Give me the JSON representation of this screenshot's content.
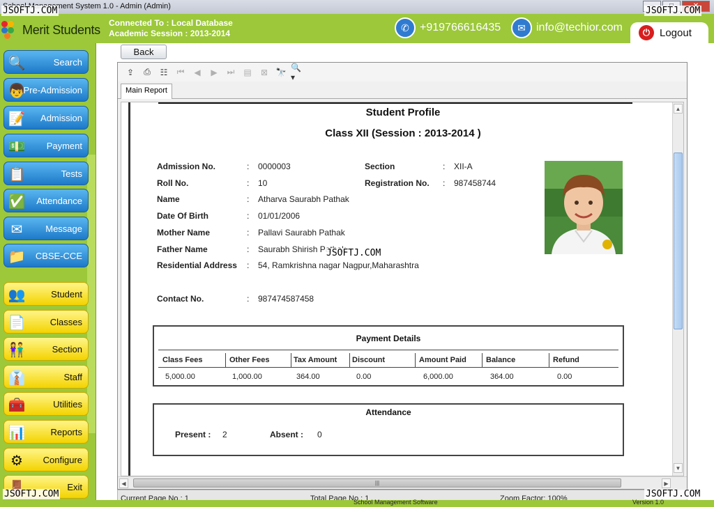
{
  "window": {
    "title": "School Management System 1.0  -  Admin (Admin)"
  },
  "header": {
    "brand": "Merit Students",
    "connection_line1": "Connected To : Local Database",
    "connection_line2": "Academic Session : 2013-2014",
    "phone": "+919766616435",
    "email": "info@techior.com",
    "logout_label": "Logout"
  },
  "sidebar": {
    "items": [
      {
        "label": "Search"
      },
      {
        "label": "Pre-Admission"
      },
      {
        "label": "Admission"
      },
      {
        "label": "Payment"
      },
      {
        "label": "Tests"
      },
      {
        "label": "Attendance"
      },
      {
        "label": "Message"
      },
      {
        "label": "CBSE-CCE"
      },
      {
        "label": "Student"
      },
      {
        "label": "Classes"
      },
      {
        "label": "Section"
      },
      {
        "label": "Staff"
      },
      {
        "label": "Utilities"
      },
      {
        "label": "Reports"
      },
      {
        "label": "Configure"
      },
      {
        "label": "Exit"
      }
    ]
  },
  "back_label": "Back",
  "viewer": {
    "tab_label": "Main Report"
  },
  "report": {
    "title": "Student Profile",
    "subtitle": "Class XII (Session : 2013-2014 )",
    "left_fields": [
      {
        "label": "Admission No.",
        "value": "0000003"
      },
      {
        "label": "Roll No.",
        "value": "10"
      },
      {
        "label": "Name",
        "value": "Atharva Saurabh Pathak"
      },
      {
        "label": "Date Of Birth",
        "value": "01/01/2006"
      },
      {
        "label": "Mother Name",
        "value": "Pallavi Saurabh Pathak"
      },
      {
        "label": "Father Name",
        "value": "Saurabh Shirish Pathak"
      },
      {
        "label": "Residential Address",
        "value": "54, Ramkrishna nagar Nagpur,Maharashtra"
      },
      {
        "label": "Contact No.",
        "value": "987474587458"
      }
    ],
    "right_fields": [
      {
        "label": "Section",
        "value": "XII-A"
      },
      {
        "label": "Registration No.",
        "value": "987458744"
      }
    ],
    "payment": {
      "title": "Payment Details",
      "headers": [
        "Class Fees",
        "Other Fees",
        "Tax Amount",
        "Discount",
        "Amount Paid",
        "Balance",
        "Refund"
      ],
      "values": [
        "5,000.00",
        "1,000.00",
        "364.00",
        "0.00",
        "6,000.00",
        "364.00",
        "0.00"
      ]
    },
    "attendance": {
      "title": "Attendance",
      "present_label": "Present :",
      "present_value": "2",
      "absent_label": "Absent :",
      "absent_value": "0"
    }
  },
  "status": {
    "current_page": "Current Page No.: 1",
    "total_page": "Total Page No.: 1",
    "software": "School Management Software",
    "zoom": "Zoom Factor: 100%",
    "version": "Version 1.0"
  },
  "watermark": "JSOFTJ.COM"
}
